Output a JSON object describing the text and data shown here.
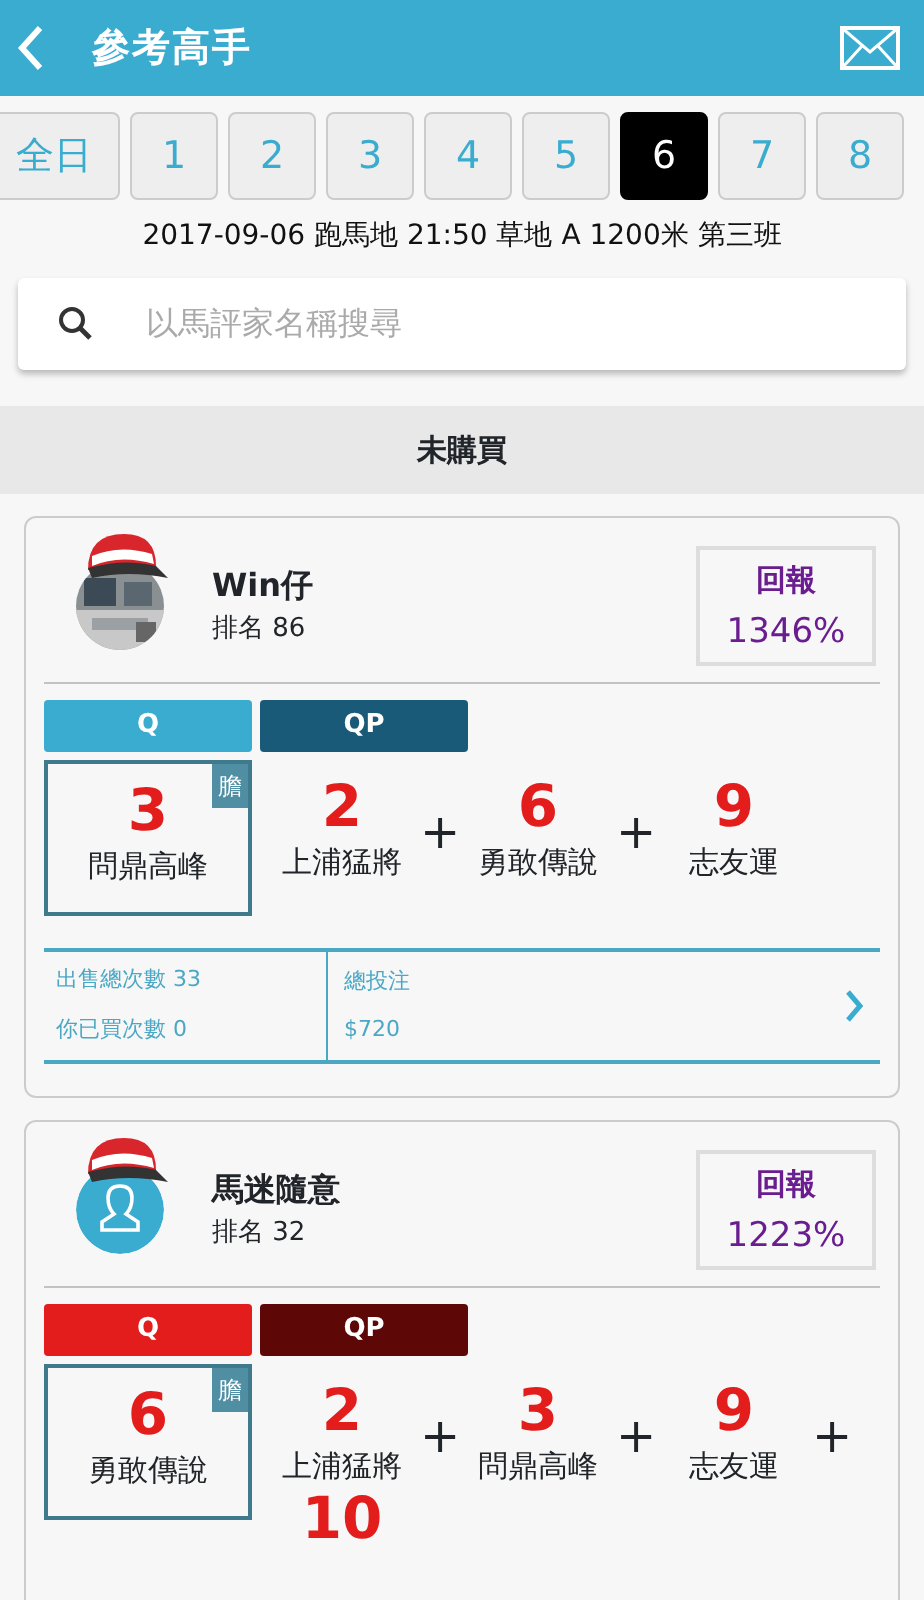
{
  "header": {
    "title": "參考高手"
  },
  "races": [
    {
      "label": "全日",
      "selected": false
    },
    {
      "label": "1",
      "selected": false
    },
    {
      "label": "2",
      "selected": false
    },
    {
      "label": "3",
      "selected": false
    },
    {
      "label": "4",
      "selected": false
    },
    {
      "label": "5",
      "selected": false
    },
    {
      "label": "6",
      "selected": true
    },
    {
      "label": "7",
      "selected": false
    },
    {
      "label": "8",
      "selected": false
    }
  ],
  "race_info": "2017-09-06 跑馬地 21:50 草地 A 1200米 第三班",
  "search": {
    "placeholder": "以馬評家名稱搜尋"
  },
  "section_title": "未購買",
  "experts": [
    {
      "name": "Win仔",
      "rank": "排名 86",
      "avatar": {
        "kind": "picture"
      },
      "return_label": "回報",
      "return_value": "1346%",
      "bet_types": [
        {
          "label": "Q",
          "color": "#3aaccf"
        },
        {
          "label": "QP",
          "color": "#195a78"
        }
      ],
      "banker": {
        "tag": "膽",
        "number": "3",
        "horse": "問鼎高峰"
      },
      "picks": [
        {
          "number": "2",
          "horse": "上浦猛將",
          "plus": "+"
        },
        {
          "number": "6",
          "horse": "勇敢傳說",
          "plus": "+"
        },
        {
          "number": "9",
          "horse": "志友運"
        }
      ],
      "stats": {
        "sold": "出售總次數 33",
        "bought": "你已買次數 0",
        "total_label": "總投注",
        "total_value": "$720"
      }
    },
    {
      "name": "馬迷隨意",
      "rank": "排名 32",
      "avatar": {
        "kind": "default"
      },
      "return_label": "回報",
      "return_value": "1223%",
      "bet_types": [
        {
          "label": "Q",
          "color": "#e31c1c"
        },
        {
          "label": "QP",
          "color": "#5e0707"
        }
      ],
      "banker": {
        "tag": "膽",
        "number": "6",
        "horse": "勇敢傳說"
      },
      "picks": [
        {
          "number": "2",
          "horse": "上浦猛將",
          "plus": "+"
        },
        {
          "number": "3",
          "horse": "問鼎高峰",
          "plus": "+"
        },
        {
          "number": "9",
          "horse": "志友運",
          "plus": "+"
        },
        {
          "number": "10"
        }
      ]
    }
  ]
}
